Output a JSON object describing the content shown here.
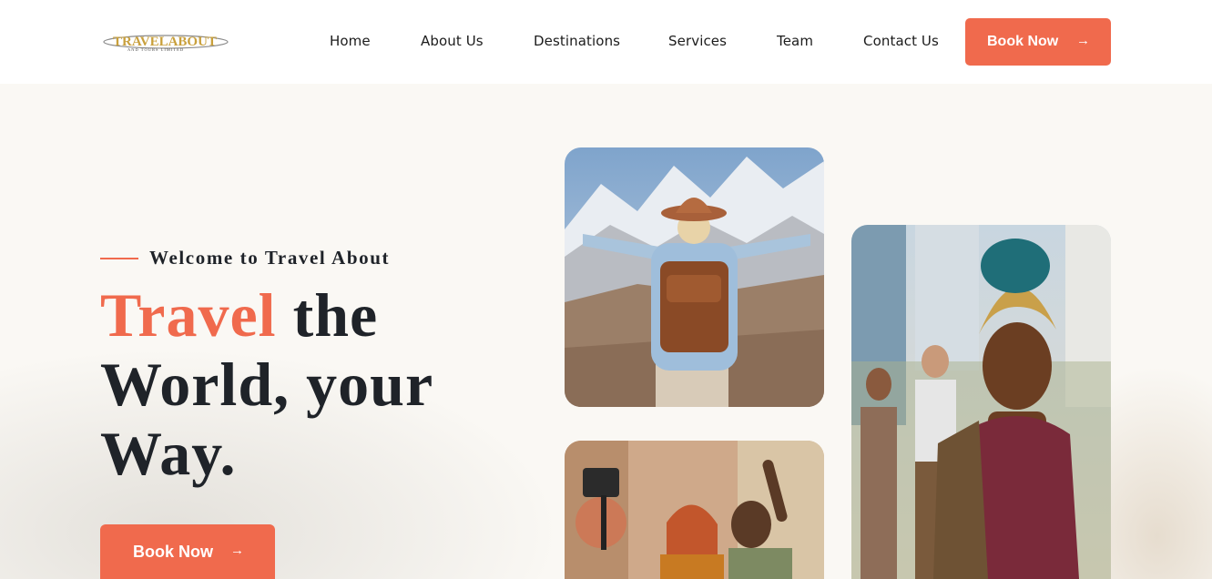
{
  "header": {
    "logo_text": "TRAVELABOUT",
    "logo_subtext": "AND TOURS LIMITED",
    "nav": [
      "Home",
      "About Us",
      "Destinations",
      "Services",
      "Team",
      "Contact Us"
    ],
    "cta_label": "Book Now",
    "cta_icon": "arrow-right-icon"
  },
  "hero": {
    "eyebrow": "Welcome to Travel About",
    "headline_accent": "Travel",
    "headline_rest_1": " the",
    "headline_rest_2": "World, your",
    "headline_rest_3": "Way.",
    "cta_label": "Book Now",
    "cta_icon": "arrow-right-icon"
  },
  "colors": {
    "accent": "#f06a4d",
    "text_dark": "#1f2329",
    "background": "#faf8f4",
    "logo_gold": "#c9a03c"
  }
}
